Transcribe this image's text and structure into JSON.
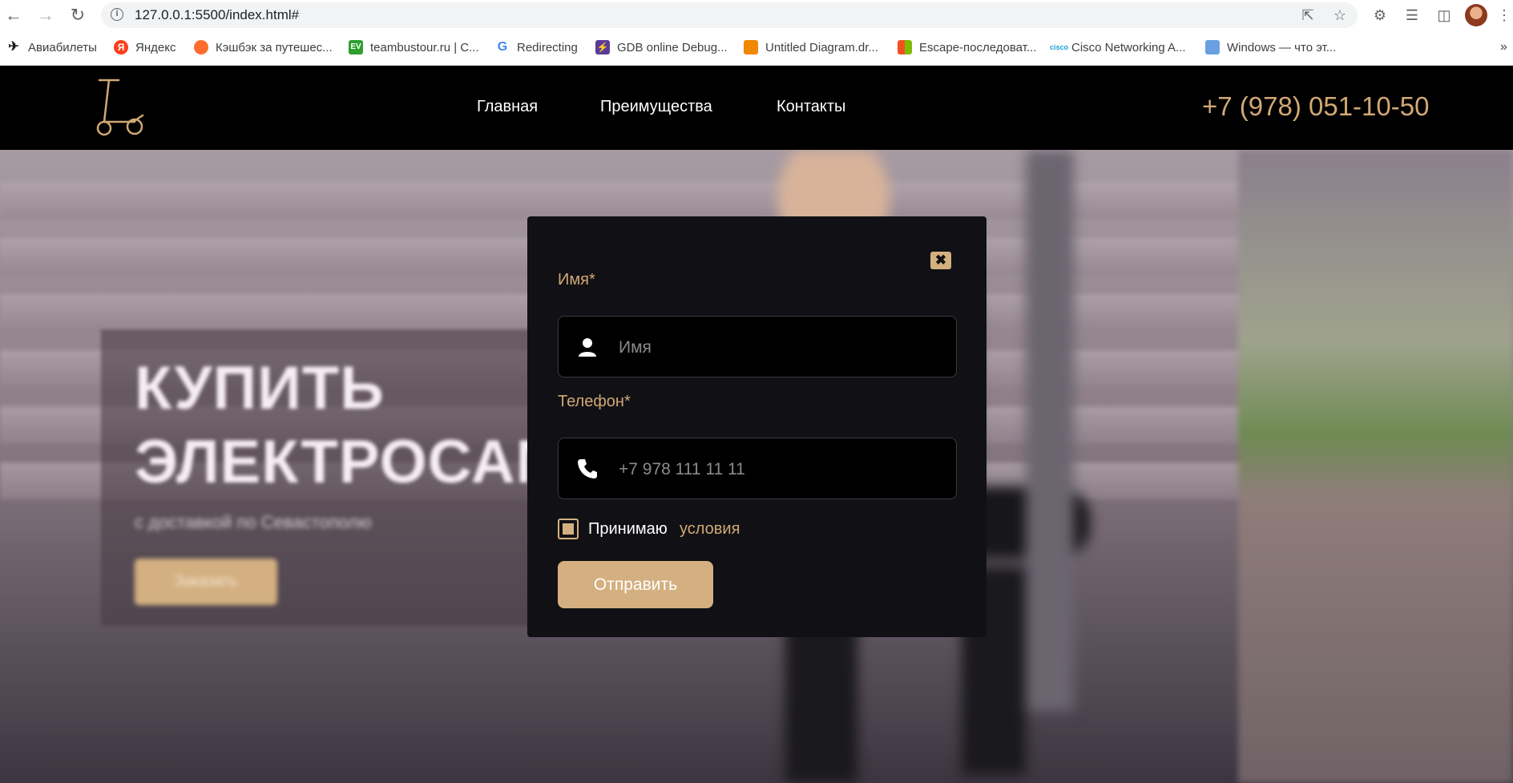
{
  "browser": {
    "url": "127.0.0.1:5500/index.html#",
    "bookmarks": [
      {
        "label": "Авиабилеты",
        "icon": "plane-icon",
        "color": "#1a73e8"
      },
      {
        "label": "Яндекс",
        "icon": "yandex-icon",
        "color": "#fc3f1d"
      },
      {
        "label": "Кэшбэк за путешес...",
        "icon": "cashback-icon",
        "color": "#ff6d2e"
      },
      {
        "label": "teambustour.ru | С...",
        "icon": "teambus-icon",
        "color": "#2e9f2e"
      },
      {
        "label": "Redirecting",
        "icon": "google-icon",
        "color": "#4285f4"
      },
      {
        "label": "GDB online Debug...",
        "icon": "gdb-icon",
        "color": "#5b3b9a"
      },
      {
        "label": "Untitled Diagram.dr...",
        "icon": "drawio-icon",
        "color": "#f08705"
      },
      {
        "label": "Escape-последоват...",
        "icon": "microsoft-icon",
        "color": "#f25022"
      },
      {
        "label": "Cisco Networking A...",
        "icon": "cisco-icon",
        "color": "#1ba0d7"
      },
      {
        "label": "Windows — что эт...",
        "icon": "flask-icon",
        "color": "#6aa0e0"
      }
    ]
  },
  "header": {
    "nav": [
      "Главная",
      "Преимущества",
      "Контакты"
    ],
    "phone": "+7 (978) 051-10-50",
    "accent_color": "#d1a874"
  },
  "hero": {
    "title": "КУПИТЬ\nЭЛЕКТРОСАМ",
    "subtitle": "с доставкой по Севастополю",
    "order_button": "Заказать"
  },
  "modal": {
    "name_label": "Имя*",
    "name_placeholder": "Имя",
    "phone_label": "Телефон*",
    "phone_placeholder": "+7 978 111 11 11",
    "terms_prefix": "Принимаю",
    "terms_link": "условия",
    "terms_checked": true,
    "submit_label": "Отправить"
  }
}
